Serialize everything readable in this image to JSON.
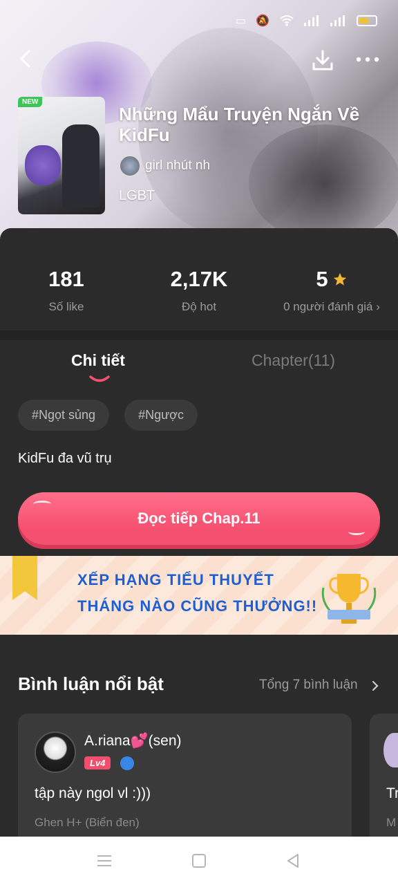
{
  "colors": {
    "accent": "#f5506f",
    "tag_bg": "#3a3a3a",
    "badge_new": "#3ec45a",
    "banner_text": "#1d5fd1",
    "star": "#f5b82e"
  },
  "header": {
    "new_badge": "NEW",
    "title": "Những Mẩu Truyện Ngắn Về KidFu",
    "author": "girl nhút nh",
    "genre": "LGBT"
  },
  "stats": [
    {
      "value": "181",
      "label": "Số like"
    },
    {
      "value": "2,17K",
      "label": "Độ hot"
    },
    {
      "value": "5",
      "label": "0 người đánh giá",
      "icon": "star-icon"
    }
  ],
  "tabs": {
    "details": "Chi tiết",
    "chapters": "Chapter(11)"
  },
  "tags": [
    "#Ngọt sủng",
    "#Ngược"
  ],
  "summary": "KidFu đa vũ trụ",
  "read_button": "Đọc tiếp Chap.11",
  "banner": {
    "line1": "XẾP HẠNG TIỂU THUYẾT",
    "line2": "THÁNG NÀO CŨNG THƯỞNG!!"
  },
  "comments": {
    "title": "Bình luận nổi bật",
    "total": "Tổng 7 bình luận",
    "items": [
      {
        "name": "A.riana💕(sen)",
        "level": "Lv4",
        "text": "tập này ngol vl :)))",
        "meta": "Ghen H+ (Biển đen)"
      },
      {
        "text": "Tr",
        "meta": "M"
      }
    ]
  }
}
